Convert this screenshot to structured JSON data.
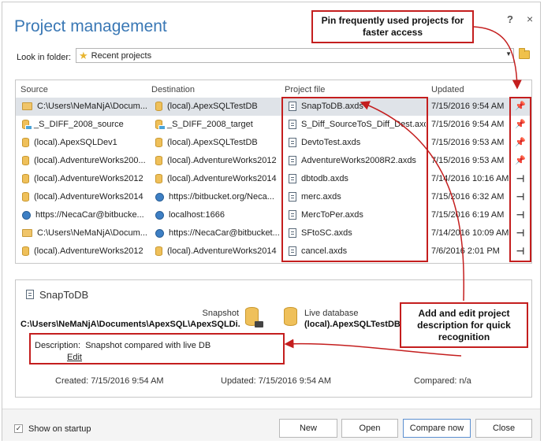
{
  "window": {
    "title": "Project management",
    "help_label": "?",
    "close_label": "×"
  },
  "folder": {
    "label": "Look in folder:",
    "value": "Recent projects",
    "icon": "star-icon"
  },
  "grid": {
    "columns": [
      "Source",
      "Destination",
      "Project file",
      "Updated"
    ],
    "rows": [
      {
        "source": "C:\\Users\\NeMaNjA\\Docum...",
        "source_icon": "folder",
        "dest": "(local).ApexSQLTestDB",
        "dest_icon": "db",
        "file": "SnapToDB.axds",
        "updated": "7/15/2016 9:54 AM",
        "pinned": true
      },
      {
        "source": "_S_DIFF_2008_source",
        "source_icon": "db-diff",
        "dest": "_S_DIFF_2008_target",
        "dest_icon": "db-diff",
        "file": "S_Diff_SourceToS_Diff_Dest.axds",
        "updated": "7/15/2016 9:54 AM",
        "pinned": true
      },
      {
        "source": "(local).ApexSQLDev1",
        "source_icon": "db",
        "dest": "(local).ApexSQLTestDB",
        "dest_icon": "db",
        "file": "DevtoTest.axds",
        "updated": "7/15/2016 9:53 AM",
        "pinned": true
      },
      {
        "source": "(local).AdventureWorks200...",
        "source_icon": "db",
        "dest": "(local).AdventureWorks2012",
        "dest_icon": "db",
        "file": "AdventureWorks2008R2.axds",
        "updated": "7/15/2016 9:53 AM",
        "pinned": true
      },
      {
        "source": "(local).AdventureWorks2012",
        "source_icon": "db",
        "dest": "(local).AdventureWorks2014",
        "dest_icon": "db",
        "file": "dbtodb.axds",
        "updated": "7/14/2016 10:16 AM",
        "pinned": false
      },
      {
        "source": "(local).AdventureWorks2014",
        "source_icon": "db",
        "dest": "https://bitbucket.org/Neca...",
        "dest_icon": "globe",
        "file": "merc.axds",
        "updated": "7/15/2016 6:32 AM",
        "pinned": false
      },
      {
        "source": "https://NecaCar@bitbucke...",
        "source_icon": "globe",
        "dest": "localhost:1666",
        "dest_icon": "globe",
        "file": "MercToPer.axds",
        "updated": "7/15/2016 6:19 AM",
        "pinned": false
      },
      {
        "source": "C:\\Users\\NeMaNjA\\Docum...",
        "source_icon": "folder",
        "dest": "https://NecaCar@bitbucket...",
        "dest_icon": "globe",
        "file": "SFtoSC.axds",
        "updated": "7/14/2016 10:09 AM",
        "pinned": false
      },
      {
        "source": "(local).AdventureWorks2012",
        "source_icon": "db",
        "dest": "(local).AdventureWorks2014",
        "dest_icon": "db",
        "file": "cancel.axds",
        "updated": "7/6/2016 2:01 PM",
        "pinned": false
      }
    ]
  },
  "details": {
    "title": "SnapToDB",
    "snapshot_label": "Snapshot",
    "snapshot_path": "C:\\Users\\NeMaNjA\\Documents\\ApexSQL\\ApexSQLDi...",
    "live_label": "Live database",
    "live_value": "(local).ApexSQLTestDB",
    "description_label": "Description:",
    "description_value": "Snapshot compared with live DB",
    "edit_label": "Edit",
    "created": "Created: 7/15/2016 9:54 AM",
    "updated": "Updated: 7/15/2016 9:54 AM",
    "compared": "Compared: n/a"
  },
  "footer": {
    "show_on_startup": "Show on startup",
    "show_on_startup_checked": true,
    "buttons": {
      "new": "New",
      "open": "Open",
      "compare_now": "Compare now",
      "close": "Close"
    }
  },
  "callouts": {
    "pin": "Pin frequently used projects for faster access",
    "description": "Add and edit project description for quick recognition"
  },
  "colors": {
    "title": "#3a78b5",
    "highlight": "#c41e1e",
    "selected_row": "#dfe3e8"
  }
}
